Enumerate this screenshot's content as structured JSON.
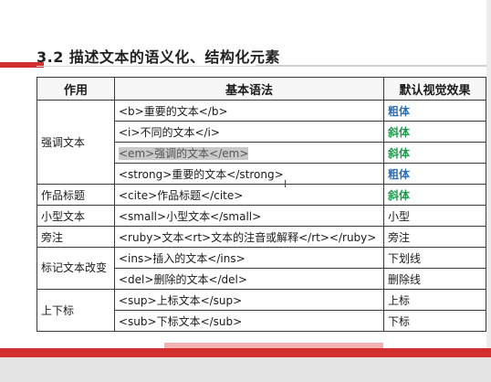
{
  "title": "3.2 描述文本的语义化、结构化元素",
  "table": {
    "headers": [
      "作用",
      "基本语法",
      "默认视觉效果"
    ],
    "groups": [
      {
        "purpose": "强调文本",
        "rows": [
          {
            "syntax": "<b>重要的文本</b>",
            "effect": "粗体"
          },
          {
            "syntax": "<i>不同的文本</i>",
            "effect": "斜体"
          },
          {
            "syntax": "<em>强调的文本</em>",
            "effect": "斜体"
          },
          {
            "syntax": "<strong>重要的文本</strong>",
            "effect": "粗体"
          }
        ]
      },
      {
        "purpose": "作品标题",
        "rows": [
          {
            "syntax": "<cite>作品标题</cite>",
            "effect": "斜体"
          }
        ]
      },
      {
        "purpose": "小型文本",
        "rows": [
          {
            "syntax": "<small>小型文本</small>",
            "effect": "小型"
          }
        ]
      },
      {
        "purpose": "旁注",
        "rows": [
          {
            "syntax": "<ruby>文本<rt>文本的注音或解释</rt></ruby>",
            "effect": "旁注"
          }
        ]
      },
      {
        "purpose": "标记文本改变",
        "rows": [
          {
            "syntax": "<ins>插入的文本</ins>",
            "effect": "下划线"
          },
          {
            "syntax": "<del>删除的文本</del>",
            "effect": "删除线"
          }
        ]
      },
      {
        "purpose": "上下标",
        "rows": [
          {
            "syntax": "<sup>上标文本</sup>",
            "effect": "上标"
          },
          {
            "syntax": "<sub>下标文本</sub>",
            "effect": "下标"
          }
        ]
      }
    ]
  },
  "colors": {
    "accent_red": "#d32f2f",
    "effect_blue": "#2f6fb5",
    "effect_green": "#1f9a4e",
    "selection_gray": "#c9c9c9"
  },
  "icons": {
    "cursor": "text-cursor-icon"
  }
}
